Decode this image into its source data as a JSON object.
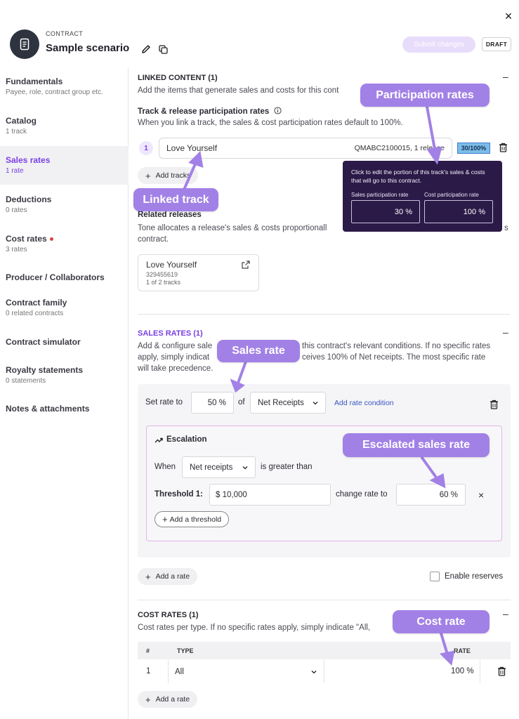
{
  "header": {
    "eyebrow": "CONTRACT",
    "title": "Sample scenario",
    "submit_label": "Submit changes",
    "status": "DRAFT",
    "close_glyph": "×"
  },
  "sidebar": {
    "items": [
      {
        "label": "Fundamentals",
        "sub": "Payee, role, contract group etc."
      },
      {
        "label": "Catalog",
        "sub": "1 track"
      },
      {
        "label": "Sales rates",
        "sub": "1 rate"
      },
      {
        "label": "Deductions",
        "sub": "0 rates"
      },
      {
        "label": "Cost rates",
        "sub": "3 rates"
      },
      {
        "label": "Producer / Collaborators",
        "sub": ""
      },
      {
        "label": "Contract family",
        "sub": "0 related contracts"
      },
      {
        "label": "Contract simulator",
        "sub": ""
      },
      {
        "label": "Royalty statements",
        "sub": "0 statements"
      },
      {
        "label": "Notes & attachments",
        "sub": ""
      }
    ]
  },
  "linked": {
    "heading": "LINKED CONTENT (1)",
    "desc": "Add the items that generate sales and costs for this cont",
    "track_heading": "Track & release participation rates",
    "track_desc": "When you link a track, the sales & cost participation rates default to 100%.",
    "row_num": "1",
    "track_name": "Love Yourself",
    "track_meta": "QMABC2100015, 1 release",
    "pct_badge": "30/100%",
    "add_tracks": "Add tracks",
    "related_heading": "Related releases",
    "related_desc1": "Tone allocates a release's sales & costs proportionall",
    "related_desc1_tail": "s",
    "related_desc2": "contract.",
    "release_name": "Love Yourself",
    "release_id": "329455619",
    "release_tracks": "1 of 2 tracks"
  },
  "tooltip": {
    "text": "Click to edit the portion of this track's sales & costs that will go to this contract.",
    "sales_label": "Sales participation rate",
    "cost_label": "Cost participation rate",
    "sales_value": "30 %",
    "cost_value": "100 %"
  },
  "sales": {
    "heading": "SALES RATES (1)",
    "desc1_a": "Add & configure sale",
    "desc1_b": "this contract's relevant conditions. If no specific rates",
    "desc2_a": "apply, simply indicat",
    "desc2_b": "ceives 100% of Net receipts. The most specific rate",
    "desc3": "will take precedence.",
    "set_rate_label": "Set rate to",
    "rate_value": "50 %",
    "of_label": "of",
    "basis": "Net Receipts",
    "add_condition": "Add rate condition",
    "escalation_title": "Escalation",
    "when_label": "When",
    "when_basis": "Net receipts",
    "greater_label": "is greater than",
    "threshold_label": "Threshold 1:",
    "threshold_value": "$ 10,000",
    "change_label": "change rate to",
    "escalated_value": "60 %",
    "remove_glyph": "×",
    "add_threshold": "Add a threshold",
    "add_rate": "Add a rate",
    "enable_reserves": "Enable reserves"
  },
  "cost": {
    "heading": "COST RATES (1)",
    "desc": "Cost rates per type. If no specific rates apply, simply indicate \"All,",
    "col_num": "#",
    "col_type": "TYPE",
    "col_rate": "RATE",
    "row_num": "1",
    "row_type": "All",
    "row_rate": "100 %",
    "add_rate": "Add a rate"
  },
  "callouts": {
    "participation": "Participation rates",
    "linked_track": "Linked track",
    "sales_rate": "Sales rate",
    "escalated": "Escalated sales rate",
    "cost_rate": "Cost rate"
  },
  "colors": {
    "accent": "#7b3fe4",
    "callout": "#a281e6",
    "tooltip_bg": "#2b1a47",
    "badge": "#7bbde8"
  }
}
